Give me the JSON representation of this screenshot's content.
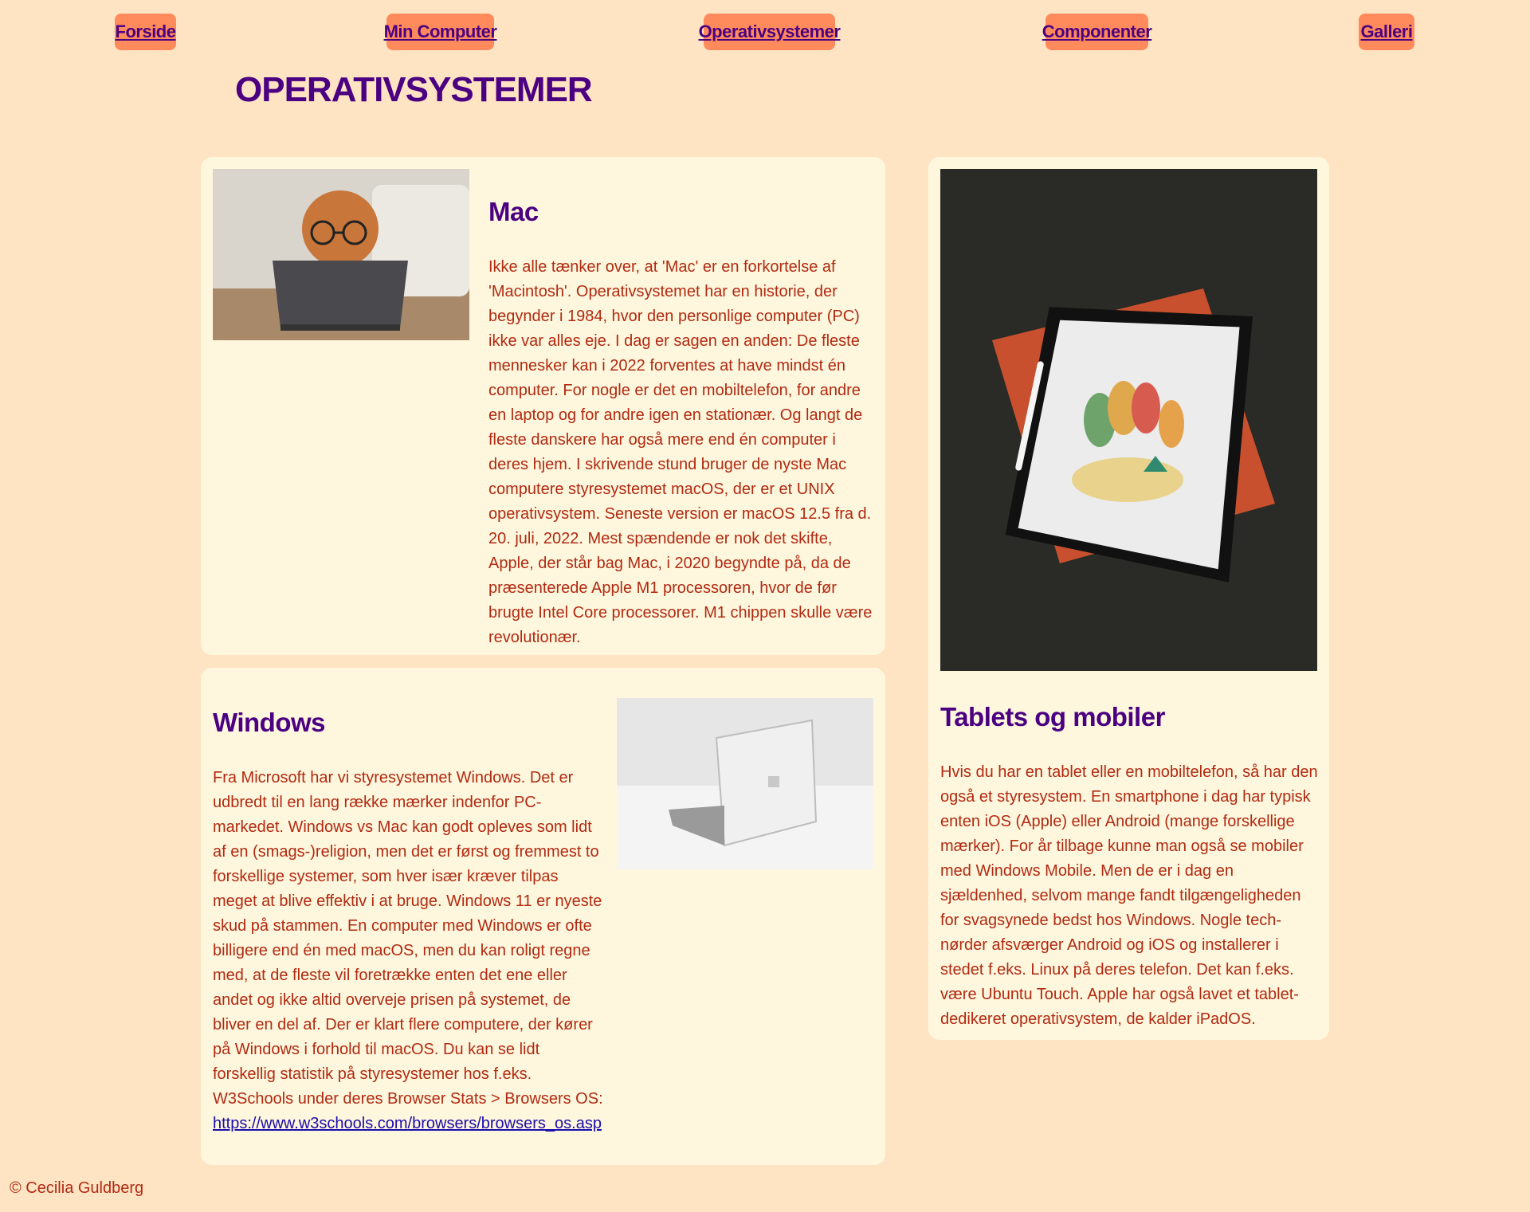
{
  "nav": {
    "items": [
      {
        "label": "Forside"
      },
      {
        "label": "Min Computer"
      },
      {
        "label": "Operativsystemer"
      },
      {
        "label": "Componenter"
      },
      {
        "label": "Galleri"
      }
    ]
  },
  "page_title": "OPERATIVSYSTEMER",
  "mac": {
    "heading": "Mac",
    "body": "Ikke alle tænker over, at 'Mac' er en forkortelse af 'Macintosh'. Operativsystemet har en historie, der begynder i 1984, hvor den personlige computer (PC) ikke var alles eje. I dag er sagen en anden: De fleste mennesker kan i 2022 forventes at have mindst én computer. For nogle er det en mobiltelefon, for andre en laptop og for andre igen en stationær. Og langt de fleste danskere har også mere end én computer i deres hjem. I skrivende stund bruger de nyste Mac computere styresystemet macOS, der er et UNIX operativsystem. Seneste version er macOS 12.5 fra d. 20. juli, 2022. Mest spændende er nok det skifte, Apple, der står bag Mac, i 2020 begyndte på, da de præsenterede Apple M1 processoren, hvor de før brugte Intel Core processorer. M1 chippen skulle være revolutionær."
  },
  "windows": {
    "heading": "Windows",
    "body": "Fra Microsoft har vi styresystemet Windows. Det er udbredt til en lang række mærker indenfor PC-markedet. Windows vs Mac kan godt opleves som lidt af en (smags-)religion, men det er først og fremmest to forskellige systemer, som hver især kræver tilpas meget at blive effektiv i at bruge. Windows 11 er nyeste skud på stammen. En computer med Windows er ofte billigere end én med macOS, men du kan roligt regne med, at de fleste vil foretrække enten det ene eller andet og ikke altid overveje prisen på systemet, de bliver en del af. Der er klart flere computere, der kører på Windows i forhold til macOS. Du kan se lidt forskellig statistik på styresystemer hos f.eks. W3Schools under deres Browser Stats > Browsers OS: ",
    "link_text": "https://www.w3schools.com/browsers/browsers_os.asp"
  },
  "tablets": {
    "heading": "Tablets og mobiler",
    "body": "Hvis du har en tablet eller en mobiltelefon, så har den også et styresystem. En smartphone i dag har typisk enten iOS (Apple) eller Android (mange forskellige mærker). For år tilbage kunne man også se mobiler med Windows Mobile. Men de er i dag en sjældenhed, selvom mange fandt tilgængeligheden for svagsynede bedst hos Windows. Nogle tech-nørder afsværger Android og iOS og installerer i stedet f.eks. Linux på deres telefon. Det kan f.eks. være Ubuntu Touch. Apple har også lavet et tablet-dedikeret operativsystem, de kalder iPadOS."
  },
  "footer": "© Cecilia Guldberg"
}
